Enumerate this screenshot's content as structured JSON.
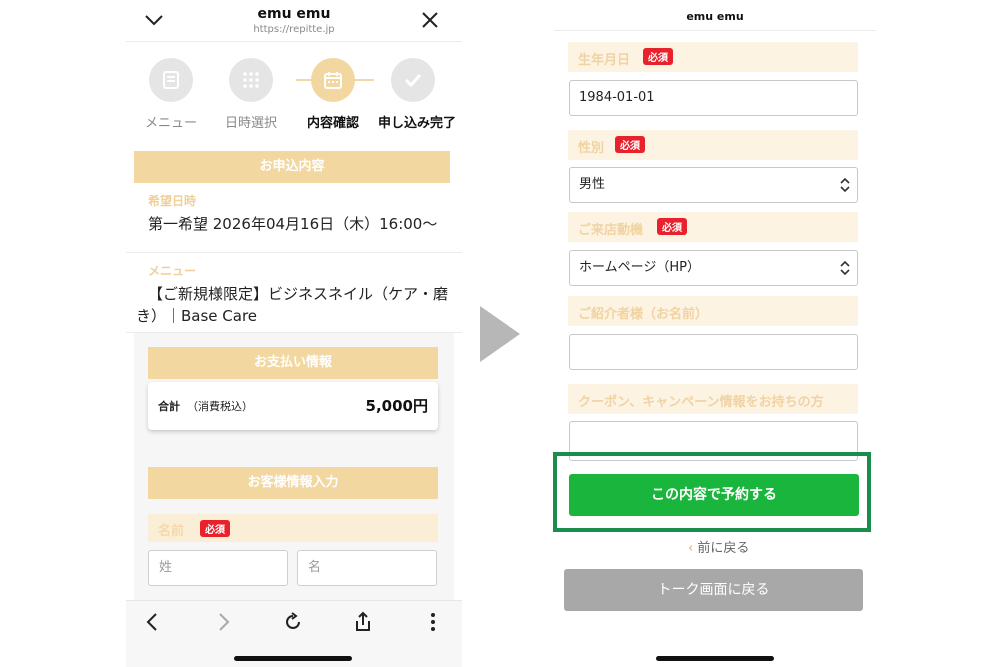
{
  "left": {
    "header": {
      "title": "emu emu",
      "url": "https://repitte.jp"
    },
    "steps": [
      {
        "label": "メニュー",
        "state": "done"
      },
      {
        "label": "日時選択",
        "state": "done"
      },
      {
        "label": "内容確認",
        "state": "active"
      },
      {
        "label": "申し込み完了",
        "state": "pending"
      }
    ],
    "application": {
      "section_title": "お申込内容",
      "desired_datetime_label": "希望日時",
      "desired_datetime_value": "第一希望 2026年04月16日（木）16:00〜",
      "menu_label": "メニュー",
      "menu_value_line1": "【ご新規様限定】ビジネスネイル（ケア・磨",
      "menu_value_line2": "き）｜Base Care"
    },
    "payment": {
      "section_title": "お支払い情報",
      "total_label": "合計",
      "tax_note": "（消費税込）",
      "total_value": "5,000円"
    },
    "customer": {
      "section_title": "お客様情報入力",
      "name_label": "名前",
      "required_badge": "必須",
      "last_name_placeholder": "姓",
      "first_name_placeholder": "名"
    }
  },
  "right": {
    "title": "emu emu",
    "fields": [
      {
        "label": "生年月日",
        "required": true,
        "value": "1984-01-01",
        "type": "text"
      },
      {
        "label": "性別",
        "required": true,
        "value": "男性",
        "type": "select"
      },
      {
        "label": "ご来店動機",
        "required": true,
        "value": "ホームページ（HP）",
        "type": "select"
      },
      {
        "label": "ご紹介者様（お名前）",
        "required": false,
        "value": "",
        "type": "text"
      },
      {
        "label": "クーポン、キャンペーン情報をお持ちの方",
        "required": false,
        "value": "",
        "type": "text"
      }
    ],
    "required_badge": "必須",
    "submit_label": "この内容で予約する",
    "back_label": "前に戻る",
    "back_chevron": "‹",
    "talk_button_label": "トーク画面に戻る",
    "colors": {
      "cta_green": "#1ab53c",
      "highlight_frame": "#1a8c4b",
      "section_gold": "#f3d7a0",
      "required_red": "#e8222d"
    }
  }
}
